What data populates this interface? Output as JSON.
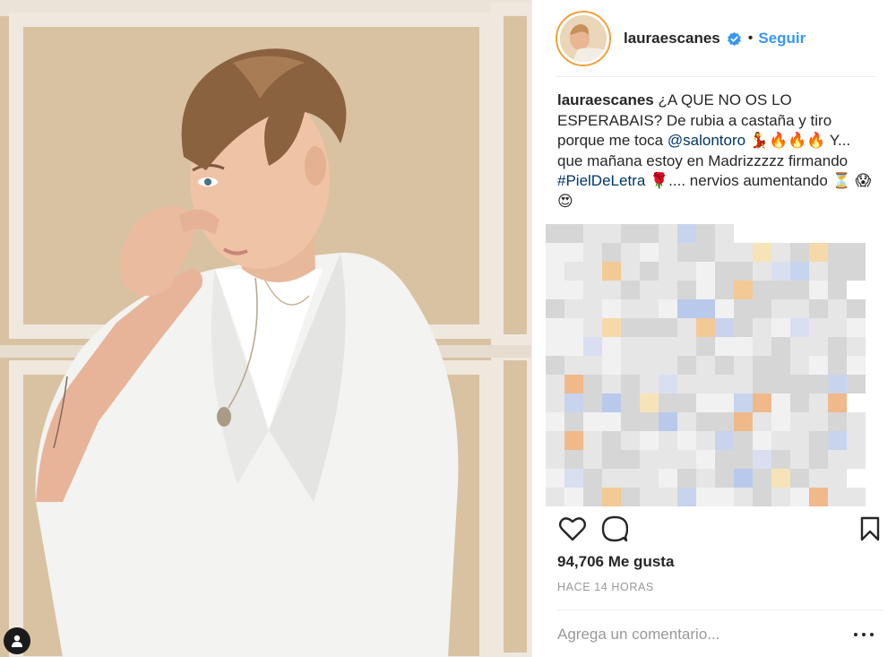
{
  "post": {
    "username": "lauraescanes",
    "follow_label": "Seguir",
    "separator": "•",
    "caption_user": "lauraescanes",
    "caption_part1": "¿A QUE NO OS LO ESPERABAIS? De rubia a castaña y tiro porque me toca",
    "mention": "@salontoro",
    "caption_part2": "💃🔥🔥🔥 Y... que mañana estoy en Madrizzzzz firmando",
    "hashtag": "#PielDeLetra",
    "caption_part3": "🌹.... nervios aumentando ⏳ 😱😍",
    "likes": "94,706 Me gusta",
    "timestamp": "HACE 14 HORAS",
    "comment_placeholder": "Agrega un comentario..."
  },
  "icons": {
    "verified": "verified-badge-icon",
    "like": "heart-icon",
    "comment": "comment-bubble-icon",
    "save": "bookmark-icon",
    "more": "more-options-icon",
    "user_tag": "user-tag-icon"
  },
  "colors": {
    "accent": "#3897f0",
    "text": "#262626",
    "muted": "#999999",
    "link": "#003569",
    "story_ring": "#f0a23b"
  }
}
